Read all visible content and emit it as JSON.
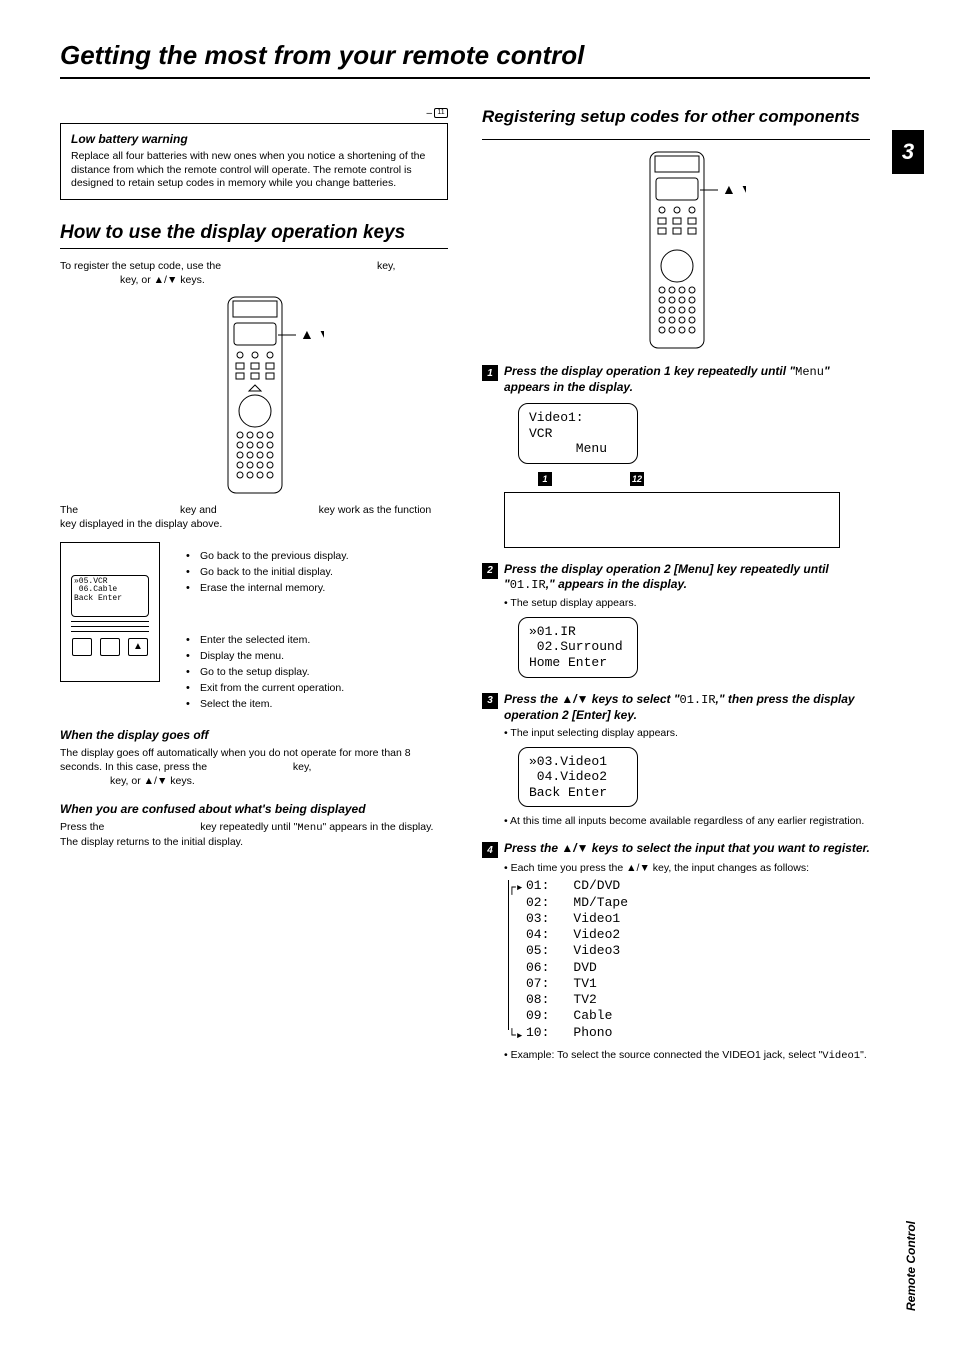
{
  "page": {
    "title": "Getting the most from your remote control",
    "number": "3",
    "sideLabel": "Remote Control",
    "pageRef": "11"
  },
  "lowBattery": {
    "heading": "Low battery warning",
    "text": "Replace all four batteries with new ones when you notice a shortening of the distance from which the remote control will operate. The remote control is designed to retain setup codes in memory while you change batteries."
  },
  "howTo": {
    "heading": "How to use the display operation keys",
    "p1a": "To register the setup code, use the",
    "p1b": "key,",
    "p1c": "key, or ▲/▼ keys.",
    "p2a": "The",
    "p2b": "key and",
    "p2c": "key work as the function key displayed in the display above."
  },
  "diagLcd": "»05.VCR\n 06.Cable\nBack Enter",
  "diagList": {
    "i1": "Go back to the previous display.",
    "i2": "Go back to the initial display.",
    "i3": "Erase the internal memory.",
    "i4": "Enter the selected item.",
    "i5": "Display the menu.",
    "i6": "Go to the setup display.",
    "i7": "Exit from the current operation.",
    "i8": "Select the item."
  },
  "displayOff": {
    "heading": "When the display goes off",
    "t1a": "The display goes off automatically when you do not operate for more than 8 seconds. In this case, press the",
    "t1b": "key,",
    "t1c": "key, or ▲/▼ keys."
  },
  "confused": {
    "heading": "When you are confused about what's being displayed",
    "t1a": "Press the",
    "t1b": "key repeatedly until \"",
    "t1c": "\" appears in the display.",
    "t2": "The display returns to the initial display.",
    "menuWord": "Menu"
  },
  "right": {
    "heading": "Registering setup codes for other components"
  },
  "step1": {
    "t1": "Press the display operation 1 key repeatedly until \"",
    "menuWord": "Menu",
    "t2": "\" appears in the display.",
    "lcd": "Video1:\nVCR\n      Menu",
    "a1": "1",
    "a2": "12"
  },
  "step2": {
    "t1": "Press the display operation 2 [Menu] key repeatedly until \"",
    "code": "01.IR",
    "t2": ",\" appears in the display.",
    "b1": "• The setup display appears.",
    "lcd": "»01.IR\n 02.Surround\nHome Enter"
  },
  "step3": {
    "t1": "Press the ▲/▼ keys to select \"",
    "code": "01.IR",
    "t2": ",\" then press the display operation 2 [Enter] key.",
    "b1": "• The input selecting display appears.",
    "lcd": "»03.Video1\n 04.Video2\nBack Enter",
    "note": "• At this time all inputs become available regardless of any earlier registration."
  },
  "step4": {
    "t1": "Press the ▲/▼ keys to select the input that you want to register.",
    "b1": "• Each time you press the ▲/▼ key, the input changes as follows:",
    "inputs": [
      {
        "n": "01:",
        "v": "CD/DVD"
      },
      {
        "n": "02:",
        "v": "MD/Tape"
      },
      {
        "n": "03:",
        "v": "Video1"
      },
      {
        "n": "04:",
        "v": "Video2"
      },
      {
        "n": "05:",
        "v": "Video3"
      },
      {
        "n": "06:",
        "v": "DVD"
      },
      {
        "n": "07:",
        "v": "TV1"
      },
      {
        "n": "08:",
        "v": "TV2"
      },
      {
        "n": "09:",
        "v": "Cable"
      },
      {
        "n": "10:",
        "v": "Phono"
      }
    ],
    "ex1": "• Example: To select the source connected the VIDEO1 jack, select \"",
    "exCode": "Video1",
    "ex2": "\"."
  }
}
